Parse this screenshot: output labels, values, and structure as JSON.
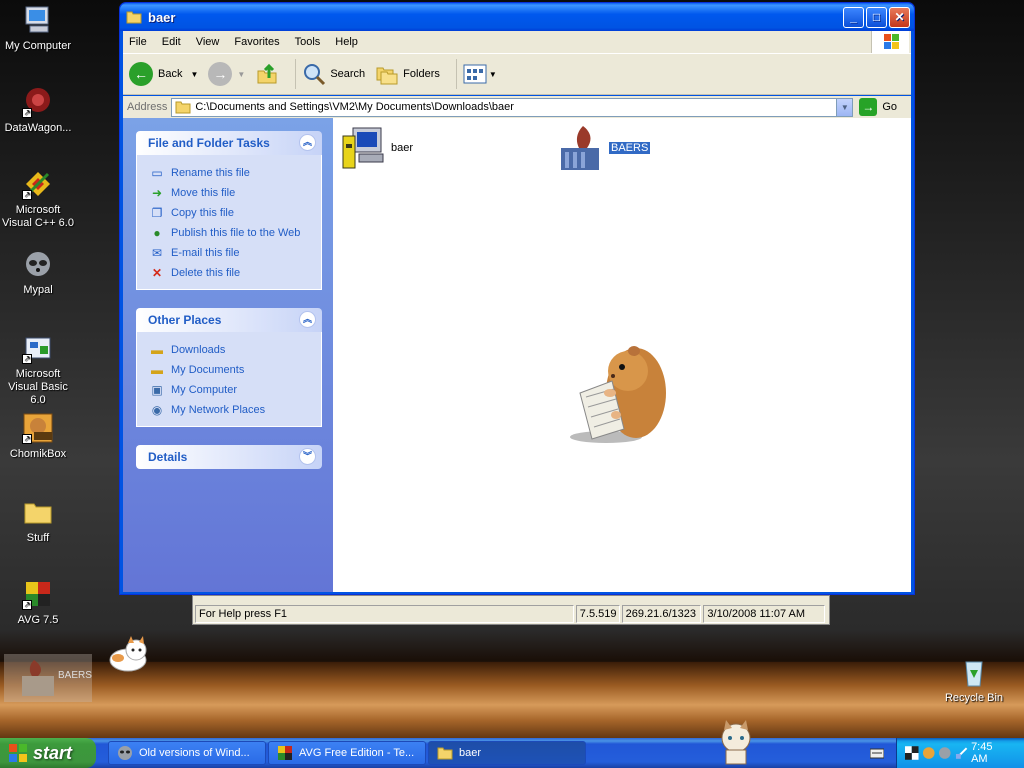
{
  "desktop": {
    "icons": [
      {
        "label": "My Computer"
      },
      {
        "label": "DataWagon..."
      },
      {
        "label": "Microsoft Visual C++ 6.0"
      },
      {
        "label": "Mypal"
      },
      {
        "label": "Microsoft Visual Basic 6.0"
      },
      {
        "label": "ChomikBox"
      },
      {
        "label": "Stuff"
      },
      {
        "label": "AVG 7.5"
      },
      {
        "label": "Recycle Bin"
      }
    ],
    "baers_thumb_label": "BAERS"
  },
  "window": {
    "title": "baer",
    "menu": [
      "File",
      "Edit",
      "View",
      "Favorites",
      "Tools",
      "Help"
    ],
    "toolbar": {
      "back": "Back",
      "search": "Search",
      "folders": "Folders"
    },
    "address": {
      "label": "Address",
      "path": "C:\\Documents and Settings\\VM2\\My Documents\\Downloads\\baer",
      "go": "Go"
    },
    "file_tasks": {
      "title": "File and Folder Tasks",
      "items": [
        {
          "label": "Rename this file",
          "icon": "rename-icon"
        },
        {
          "label": "Move this file",
          "icon": "move-icon"
        },
        {
          "label": "Copy this file",
          "icon": "copy-icon"
        },
        {
          "label": "Publish this file to the Web",
          "icon": "publish-icon"
        },
        {
          "label": "E-mail this file",
          "icon": "email-icon"
        },
        {
          "label": "Delete this file",
          "icon": "delete-icon"
        }
      ]
    },
    "other_places": {
      "title": "Other Places",
      "items": [
        {
          "label": "Downloads",
          "icon": "folder-icon"
        },
        {
          "label": "My Documents",
          "icon": "my-documents-icon"
        },
        {
          "label": "My Computer",
          "icon": "my-computer-icon"
        },
        {
          "label": "My Network Places",
          "icon": "network-icon"
        }
      ]
    },
    "details": {
      "title": "Details"
    },
    "files": [
      {
        "name": "baer",
        "selected": false
      },
      {
        "name": "BAERS",
        "selected": true
      }
    ]
  },
  "background_window": {
    "status": [
      "For Help press F1",
      "7.5.519",
      "269.21.6/1323",
      "3/10/2008 11:07 AM"
    ]
  },
  "taskbar": {
    "start": "start",
    "tasks": [
      {
        "label": "Old versions of Wind...",
        "active": false
      },
      {
        "label": "AVG Free Edition - Te...",
        "active": false
      },
      {
        "label": "baer",
        "active": true
      }
    ],
    "clock": "7:45 AM"
  }
}
